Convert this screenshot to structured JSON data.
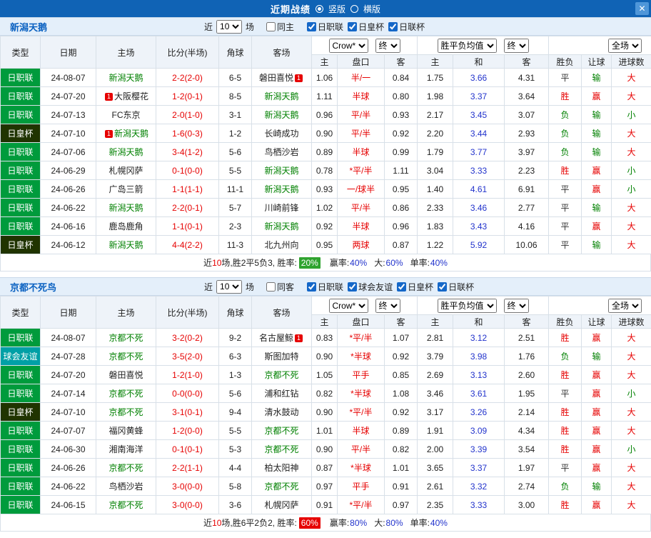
{
  "titlebar": {
    "title": "近期战绩",
    "layout_options": [
      {
        "label": "竖版",
        "selected": true
      },
      {
        "label": "横版",
        "selected": false
      }
    ],
    "close_icon": "✕"
  },
  "controls": {
    "near_label": "近",
    "matches_label": "场",
    "bookmaker": "Crow*",
    "final": "终",
    "avg_odds": "胜平负均值",
    "scope": "全场"
  },
  "columns": [
    "类型",
    "日期",
    "主场",
    "比分(半场)",
    "角球",
    "客场",
    "主",
    "盘口",
    "客",
    "主",
    "和",
    "客",
    "胜负",
    "让球",
    "进球数"
  ],
  "colors": {
    "league_bg": {
      "日职联": "#009B3C",
      "日皇杯": "#203400",
      "球会友谊": "#00A0A6",
      "日联杯": "#009B3C"
    },
    "focus_team": "#008000",
    "opponent_team": "#222222",
    "score": "#E60000",
    "handicap": "#E60000",
    "avg_draw": "#2233CC",
    "result": {
      "胜": "#E60000",
      "平": "#333333",
      "负": "#008000"
    },
    "handicap_result": {
      "赢": "#E60000",
      "输": "#008000"
    },
    "goals": {
      "大": "#E60000",
      "小": "#008000"
    }
  },
  "sections": [
    {
      "team": "新潟天鹅",
      "near_value": "10",
      "same_label": "同主",
      "same_checked": false,
      "league_filters": [
        {
          "label": "日职联",
          "checked": true
        },
        {
          "label": "日皇杯",
          "checked": true
        },
        {
          "label": "日联杯",
          "checked": true
        }
      ],
      "rows": [
        {
          "league": "日职联",
          "date": "24-08-07",
          "home": "新潟天鹅",
          "home_focus": true,
          "score": "2-2(2-0)",
          "corners": "6-5",
          "away": "磐田喜悦",
          "away_focus": false,
          "away_mark": {
            "text": "1",
            "pos": "right"
          },
          "odds_home": "1.06",
          "handicap": "半/一",
          "odds_away": "0.84",
          "avg_home": "1.75",
          "avg_draw": "3.66",
          "avg_away": "4.31",
          "result": "平",
          "handicap_result": "输",
          "goals": "大"
        },
        {
          "league": "日职联",
          "date": "24-07-20",
          "home": "大阪樱花",
          "home_focus": false,
          "home_mark": {
            "text": "1",
            "pos": "left"
          },
          "score": "1-2(0-1)",
          "corners": "8-5",
          "away": "新潟天鹅",
          "away_focus": true,
          "odds_home": "1.11",
          "handicap": "半球",
          "odds_away": "0.80",
          "avg_home": "1.98",
          "avg_draw": "3.37",
          "avg_away": "3.64",
          "result": "胜",
          "handicap_result": "赢",
          "goals": "大"
        },
        {
          "league": "日职联",
          "date": "24-07-13",
          "home": "FC东京",
          "home_focus": false,
          "score": "2-0(1-0)",
          "corners": "3-1",
          "away": "新潟天鹅",
          "away_focus": true,
          "odds_home": "0.96",
          "handicap": "平/半",
          "odds_away": "0.93",
          "avg_home": "2.17",
          "avg_draw": "3.45",
          "avg_away": "3.07",
          "result": "负",
          "handicap_result": "输",
          "goals": "小"
        },
        {
          "league": "日皇杯",
          "date": "24-07-10",
          "home": "新潟天鹅",
          "home_focus": true,
          "home_mark": {
            "text": "1",
            "pos": "left"
          },
          "score": "1-6(0-3)",
          "corners": "1-2",
          "away": "长崎成功",
          "away_focus": false,
          "odds_home": "0.90",
          "handicap": "平/半",
          "odds_away": "0.92",
          "avg_home": "2.20",
          "avg_draw": "3.44",
          "avg_away": "2.93",
          "result": "负",
          "handicap_result": "输",
          "goals": "大"
        },
        {
          "league": "日职联",
          "date": "24-07-06",
          "home": "新潟天鹅",
          "home_focus": true,
          "score": "3-4(1-2)",
          "corners": "5-6",
          "away": "鸟栖沙岩",
          "away_focus": false,
          "odds_home": "0.89",
          "handicap": "半球",
          "odds_away": "0.99",
          "avg_home": "1.79",
          "avg_draw": "3.77",
          "avg_away": "3.97",
          "result": "负",
          "handicap_result": "输",
          "goals": "大"
        },
        {
          "league": "日职联",
          "date": "24-06-29",
          "home": "札幌冈萨",
          "home_focus": false,
          "score": "0-1(0-0)",
          "corners": "5-5",
          "away": "新潟天鹅",
          "away_focus": true,
          "odds_home": "0.78",
          "handicap": "*平/半",
          "odds_away": "1.11",
          "avg_home": "3.04",
          "avg_draw": "3.33",
          "avg_away": "2.23",
          "result": "胜",
          "handicap_result": "赢",
          "goals": "小"
        },
        {
          "league": "日职联",
          "date": "24-06-26",
          "home": "广岛三箭",
          "home_focus": false,
          "score": "1-1(1-1)",
          "corners": "11-1",
          "away": "新潟天鹅",
          "away_focus": true,
          "odds_home": "0.93",
          "handicap": "一/球半",
          "odds_away": "0.95",
          "avg_home": "1.40",
          "avg_draw": "4.61",
          "avg_away": "6.91",
          "result": "平",
          "handicap_result": "赢",
          "goals": "小"
        },
        {
          "league": "日职联",
          "date": "24-06-22",
          "home": "新潟天鹅",
          "home_focus": true,
          "score": "2-2(0-1)",
          "corners": "5-7",
          "away": "川崎前锋",
          "away_focus": false,
          "odds_home": "1.02",
          "handicap": "平/半",
          "odds_away": "0.86",
          "avg_home": "2.33",
          "avg_draw": "3.46",
          "avg_away": "2.77",
          "result": "平",
          "handicap_result": "输",
          "goals": "大"
        },
        {
          "league": "日职联",
          "date": "24-06-16",
          "home": "鹿岛鹿角",
          "home_focus": false,
          "score": "1-1(0-1)",
          "corners": "2-3",
          "away": "新潟天鹅",
          "away_focus": true,
          "odds_home": "0.92",
          "handicap": "半球",
          "odds_away": "0.96",
          "avg_home": "1.83",
          "avg_draw": "3.43",
          "avg_away": "4.16",
          "result": "平",
          "handicap_result": "赢",
          "goals": "大"
        },
        {
          "league": "日皇杯",
          "date": "24-06-12",
          "home": "新潟天鹅",
          "home_focus": true,
          "score": "4-4(2-2)",
          "corners": "11-3",
          "away": "北九州向",
          "away_focus": false,
          "odds_home": "0.95",
          "handicap": "两球",
          "odds_away": "0.87",
          "avg_home": "1.22",
          "avg_draw": "5.92",
          "avg_away": "10.06",
          "result": "平",
          "handicap_result": "输",
          "goals": "大"
        }
      ],
      "summary": {
        "prefix": "近",
        "count": "10",
        "mid": "场,胜2平5负3, 胜率:",
        "rate": "20%",
        "badge_bg": "#2FA32F",
        "stats": [
          {
            "label": "赢率:",
            "value": "40%"
          },
          {
            "label": "大:",
            "value": "60%"
          },
          {
            "label": "单率:",
            "value": "40%"
          }
        ]
      }
    },
    {
      "team": "京都不死鸟",
      "near_value": "10",
      "same_label": "同客",
      "same_checked": false,
      "league_filters": [
        {
          "label": "日职联",
          "checked": true
        },
        {
          "label": "球会友谊",
          "checked": true
        },
        {
          "label": "日皇杯",
          "checked": true
        },
        {
          "label": "日联杯",
          "checked": true
        }
      ],
      "rows": [
        {
          "league": "日职联",
          "date": "24-08-07",
          "home": "京都不死",
          "home_focus": true,
          "score": "3-2(0-2)",
          "corners": "9-2",
          "away": "名古屋鲸",
          "away_focus": false,
          "away_mark": {
            "text": "1",
            "pos": "right"
          },
          "odds_home": "0.83",
          "handicap": "*平/半",
          "odds_away": "1.07",
          "avg_home": "2.81",
          "avg_draw": "3.12",
          "avg_away": "2.51",
          "result": "胜",
          "handicap_result": "赢",
          "goals": "大"
        },
        {
          "league": "球会友谊",
          "date": "24-07-28",
          "home": "京都不死",
          "home_focus": true,
          "score": "3-5(2-0)",
          "corners": "6-3",
          "away": "斯图加特",
          "away_focus": false,
          "odds_home": "0.90",
          "handicap": "*半球",
          "odds_away": "0.92",
          "avg_home": "3.79",
          "avg_draw": "3.98",
          "avg_away": "1.76",
          "result": "负",
          "handicap_result": "输",
          "goals": "大"
        },
        {
          "league": "日职联",
          "date": "24-07-20",
          "home": "磐田喜悦",
          "home_focus": false,
          "score": "1-2(1-0)",
          "corners": "1-3",
          "away": "京都不死",
          "away_focus": true,
          "odds_home": "1.05",
          "handicap": "平手",
          "odds_away": "0.85",
          "avg_home": "2.69",
          "avg_draw": "3.13",
          "avg_away": "2.60",
          "result": "胜",
          "handicap_result": "赢",
          "goals": "大"
        },
        {
          "league": "日职联",
          "date": "24-07-14",
          "home": "京都不死",
          "home_focus": true,
          "score": "0-0(0-0)",
          "corners": "5-6",
          "away": "浦和红钻",
          "away_focus": false,
          "odds_home": "0.82",
          "handicap": "*半球",
          "odds_away": "1.08",
          "avg_home": "3.46",
          "avg_draw": "3.61",
          "avg_away": "1.95",
          "result": "平",
          "handicap_result": "赢",
          "goals": "小"
        },
        {
          "league": "日皇杯",
          "date": "24-07-10",
          "home": "京都不死",
          "home_focus": true,
          "score": "3-1(0-1)",
          "corners": "9-4",
          "away": "清水鼓动",
          "away_focus": false,
          "odds_home": "0.90",
          "handicap": "*平/半",
          "odds_away": "0.92",
          "avg_home": "3.17",
          "avg_draw": "3.26",
          "avg_away": "2.14",
          "result": "胜",
          "handicap_result": "赢",
          "goals": "大"
        },
        {
          "league": "日职联",
          "date": "24-07-07",
          "home": "福冈黄蜂",
          "home_focus": false,
          "score": "1-2(0-0)",
          "corners": "5-5",
          "away": "京都不死",
          "away_focus": true,
          "odds_home": "1.01",
          "handicap": "半球",
          "odds_away": "0.89",
          "avg_home": "1.91",
          "avg_draw": "3.09",
          "avg_away": "4.34",
          "result": "胜",
          "handicap_result": "赢",
          "goals": "大"
        },
        {
          "league": "日职联",
          "date": "24-06-30",
          "home": "湘南海洋",
          "home_focus": false,
          "score": "0-1(0-1)",
          "corners": "5-3",
          "away": "京都不死",
          "away_focus": true,
          "odds_home": "0.90",
          "handicap": "平/半",
          "odds_away": "0.82",
          "avg_home": "2.00",
          "avg_draw": "3.39",
          "avg_away": "3.54",
          "result": "胜",
          "handicap_result": "赢",
          "goals": "小"
        },
        {
          "league": "日职联",
          "date": "24-06-26",
          "home": "京都不死",
          "home_focus": true,
          "score": "2-2(1-1)",
          "corners": "4-4",
          "away": "柏太阳神",
          "away_focus": false,
          "odds_home": "0.87",
          "handicap": "*半球",
          "odds_away": "1.01",
          "avg_home": "3.65",
          "avg_draw": "3.37",
          "avg_away": "1.97",
          "result": "平",
          "handicap_result": "赢",
          "goals": "大"
        },
        {
          "league": "日职联",
          "date": "24-06-22",
          "home": "鸟栖沙岩",
          "home_focus": false,
          "score": "3-0(0-0)",
          "corners": "5-8",
          "away": "京都不死",
          "away_focus": true,
          "odds_home": "0.97",
          "handicap": "平手",
          "odds_away": "0.91",
          "avg_home": "2.61",
          "avg_draw": "3.32",
          "avg_away": "2.74",
          "result": "负",
          "handicap_result": "输",
          "goals": "大"
        },
        {
          "league": "日职联",
          "date": "24-06-15",
          "home": "京都不死",
          "home_focus": true,
          "score": "3-0(0-0)",
          "corners": "3-6",
          "away": "札幌冈萨",
          "away_focus": false,
          "odds_home": "0.91",
          "handicap": "*平/半",
          "odds_away": "0.97",
          "avg_home": "2.35",
          "avg_draw": "3.33",
          "avg_away": "3.00",
          "result": "胜",
          "handicap_result": "赢",
          "goals": "大"
        }
      ],
      "summary": {
        "prefix": "近",
        "count": "10",
        "mid": "场,胜6平2负2, 胜率:",
        "rate": "60%",
        "badge_bg": "#E60000",
        "stats": [
          {
            "label": "赢率:",
            "value": "80%"
          },
          {
            "label": "大:",
            "value": "80%"
          },
          {
            "label": "单率:",
            "value": "40%"
          }
        ]
      }
    }
  ]
}
